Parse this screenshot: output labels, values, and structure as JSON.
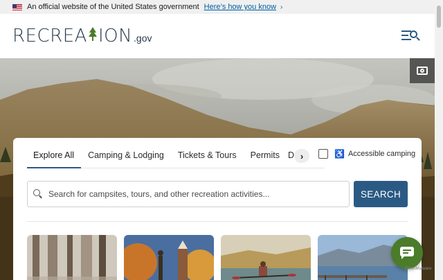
{
  "gov_banner": {
    "text": "An official website of the United States government",
    "link": "Here’s how you know",
    "chevron": "›"
  },
  "header": {
    "logo_left": "RECRE",
    "logo_mid": "A",
    "logo_tree": "⚲",
    "logo_right": "ION",
    "logo_gov": ".gov",
    "menu_icon": "menu-search-icon"
  },
  "hero": {
    "camera_icon": "camera-icon"
  },
  "search_card": {
    "tabs": [
      {
        "label": "Explore All"
      },
      {
        "label": "Camping & Lodging"
      },
      {
        "label": "Tickets & Tours"
      },
      {
        "label": "Permits"
      },
      {
        "label": "Da"
      }
    ],
    "next_arrow": "›",
    "accessible_label": "Accessible camping",
    "accessible_checked": false,
    "search_placeholder": "Search for campsites, tours, and other recreation activities...",
    "search_button": "SEARCH"
  },
  "chat": {
    "icon": "chat-icon",
    "badge": "CleanMalware"
  },
  "colors": {
    "brand_blue": "#2a5a84",
    "brand_green": "#4a7c2a",
    "gov_link": "#005ea2"
  }
}
